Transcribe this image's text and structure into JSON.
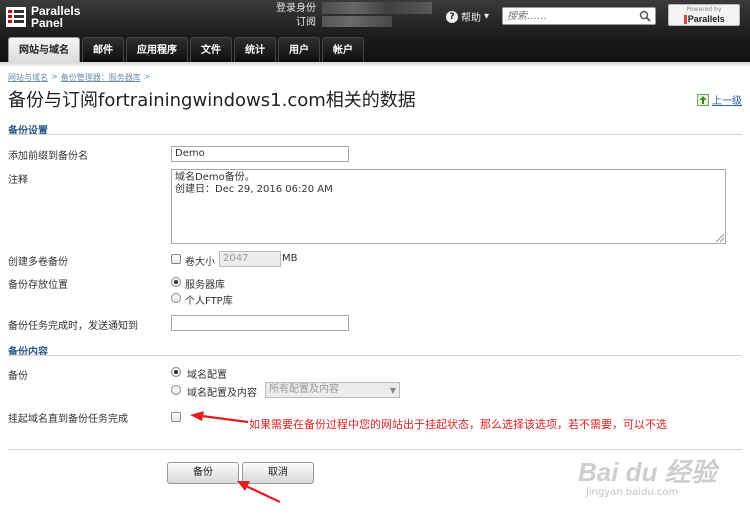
{
  "header": {
    "brand_line1": "Parallels",
    "brand_line2": "Panel",
    "login_label": "登录身份",
    "subscription_label": "订阅",
    "help_label": "帮助",
    "search_placeholder": "搜索……",
    "powered_by": "Powered by",
    "powered_brand": "Parallels"
  },
  "tabs": [
    {
      "label": "网站与域名",
      "active": true
    },
    {
      "label": "邮件"
    },
    {
      "label": "应用程序"
    },
    {
      "label": "文件"
    },
    {
      "label": "统计"
    },
    {
      "label": "用户"
    },
    {
      "label": "帐户"
    }
  ],
  "breadcrumb": {
    "items": [
      "网站与域名",
      "备份管理器：服务器库"
    ],
    "separator": ">"
  },
  "page": {
    "title": "备份与订阅fortrainingwindows1.com相关的数据",
    "up_level": "上一级"
  },
  "backup_settings": {
    "section_title": "备份设置",
    "prefix_label": "添加前缀到备份名",
    "prefix_value": "Demo",
    "comment_label": "注释",
    "comment_line1": "域名Demo备份。",
    "comment_line2": "创建日：Dec 29, 2016 06:20 AM",
    "multivolume_label": "创建多卷备份",
    "volume_size_label": "卷大小",
    "volume_size_value": "2047",
    "volume_unit": "MB",
    "location_label": "备份存放位置",
    "location_options": [
      "服务器库",
      "个人FTP库"
    ],
    "location_selected": "服务器库",
    "notify_label": "备份任务完成时，发送通知到",
    "notify_value": ""
  },
  "backup_content": {
    "section_title": "备份内容",
    "backup_label": "备份",
    "options": [
      "域名配置",
      "域名配置及内容"
    ],
    "selected": "域名配置",
    "content_select_value": "所有配置及内容",
    "suspend_label": "挂起域名直到备份任务完成",
    "suspend_checked": false
  },
  "annotation": {
    "note": "如果需要在备份过程中您的网站出于挂起状态，那么选择该选项，若不需要，可以不选"
  },
  "buttons": {
    "backup": "备份",
    "cancel": "取消"
  },
  "watermark": {
    "line1": "Bai du 经验",
    "line2": "jingyan.baidu.com"
  },
  "colors": {
    "section_title": "#2b5a8a",
    "link": "#2a62a6",
    "annotation": "#e02020"
  }
}
